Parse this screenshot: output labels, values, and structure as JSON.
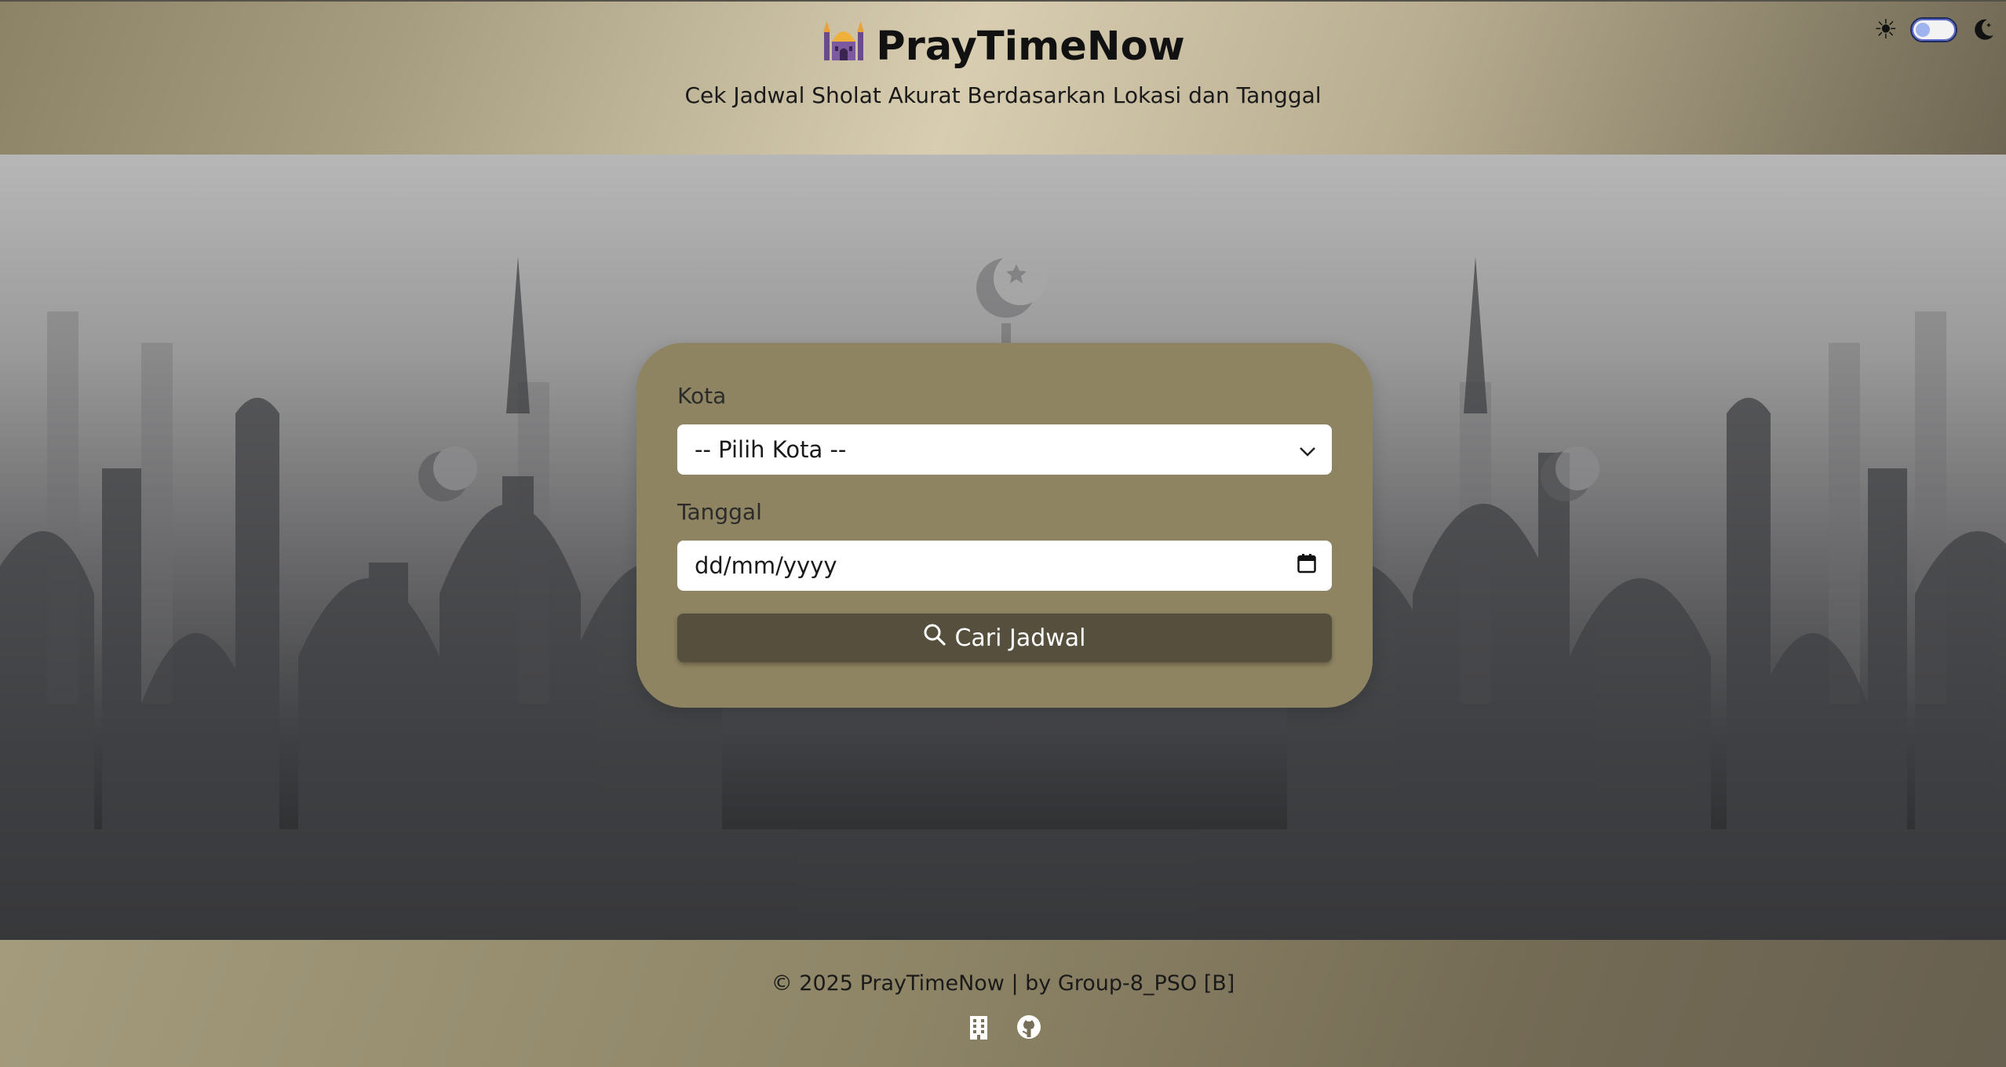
{
  "header": {
    "title": "PrayTimeNow",
    "subtitle": "Cek Jadwal Sholat Akurat Berdasarkan Lokasi dan Tanggal",
    "brand_icon": "mosque-icon"
  },
  "theme_toggle": {
    "light_icon": "sun-icon",
    "dark_icon": "moon-icon",
    "state": "light"
  },
  "form": {
    "city_label": "Kota",
    "city_selected": "-- Pilih Kota --",
    "date_label": "Tanggal",
    "date_value": "dd/mm/yyyy",
    "search_label": "Cari Jadwal"
  },
  "footer": {
    "copyright": "© 2025 PrayTimeNow | by Group-8_PSO [B]",
    "links": [
      "building-icon",
      "github-icon"
    ]
  },
  "colors": {
    "card": "#8e8462",
    "button": "#564f3d",
    "header_light": "#d8cdb0"
  }
}
